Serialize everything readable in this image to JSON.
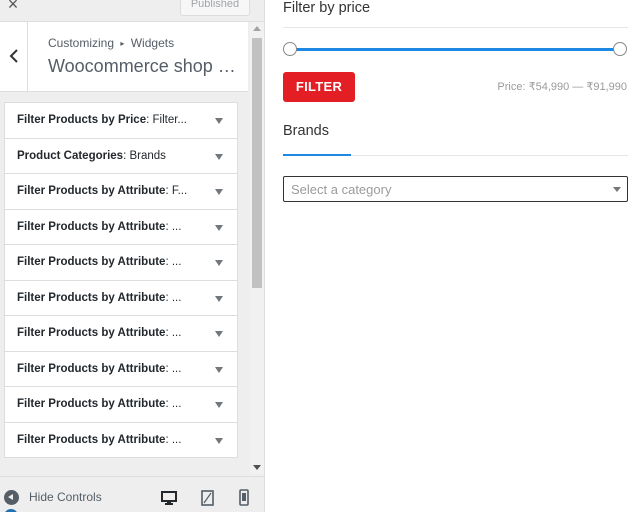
{
  "topbar": {
    "close_glyph": "×",
    "publish_label": "Published"
  },
  "section": {
    "breadcrumb_root": "Customizing",
    "breadcrumb_separator": "▸",
    "breadcrumb_current": "Widgets",
    "title": "Woocommerce shop si..."
  },
  "widgets": [
    {
      "title": "Filter Products by Price",
      "subtitle": "Filter..."
    },
    {
      "title": "Product Categories",
      "subtitle": "Brands"
    },
    {
      "title": "Filter Products by Attribute",
      "subtitle": "F..."
    },
    {
      "title": "Filter Products by Attribute",
      "subtitle": "..."
    },
    {
      "title": "Filter Products by Attribute",
      "subtitle": "..."
    },
    {
      "title": "Filter Products by Attribute",
      "subtitle": "..."
    },
    {
      "title": "Filter Products by Attribute",
      "subtitle": "..."
    },
    {
      "title": "Filter Products by Attribute",
      "subtitle": "..."
    },
    {
      "title": "Filter Products by Attribute",
      "subtitle": "..."
    },
    {
      "title": "Filter Products by Attribute",
      "subtitle": "..."
    }
  ],
  "footer": {
    "hide_controls_label": "Hide Controls",
    "devices": [
      "desktop-icon",
      "tablet-icon",
      "mobile-icon"
    ]
  },
  "preview": {
    "filter_heading": "Filter by price",
    "filter_button": "FILTER",
    "price_range": "Price: ₹54,990 — ₹91,990",
    "slider_min_fraction": 0,
    "slider_max_fraction": 1,
    "brands_heading": "Brands",
    "category_placeholder": "Select a category"
  },
  "colors": {
    "accent_blue": "#1e88e5",
    "filter_button_red": "#e31e24",
    "sidebar_bg": "#eeeeee"
  }
}
